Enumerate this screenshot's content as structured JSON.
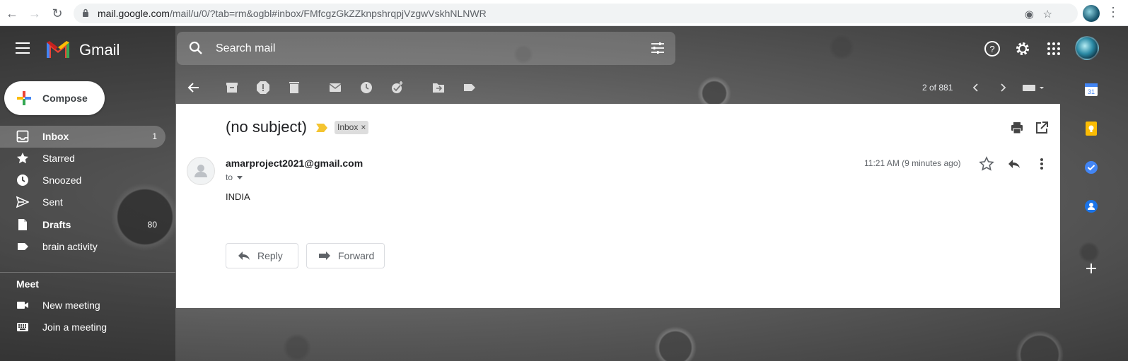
{
  "browser": {
    "url_host": "mail.google.com",
    "url_path": "/mail/u/0/?tab=rm&ogbl#inbox/FMfcgzGkZZknpshrqpjVzgwVskhNLNWR"
  },
  "header": {
    "app_name": "Gmail",
    "search_placeholder": "Search mail"
  },
  "compose": {
    "label": "Compose"
  },
  "sidebar": {
    "items": [
      {
        "label": "Inbox",
        "count": "1"
      },
      {
        "label": "Starred",
        "count": ""
      },
      {
        "label": "Snoozed",
        "count": ""
      },
      {
        "label": "Sent",
        "count": ""
      },
      {
        "label": "Drafts",
        "count": "80"
      },
      {
        "label": "brain activity",
        "count": ""
      }
    ],
    "meet_title": "Meet",
    "meet_items": [
      {
        "label": "New meeting"
      },
      {
        "label": "Join a meeting"
      }
    ]
  },
  "toolbar": {
    "pager": "2 of 881"
  },
  "message": {
    "subject": "(no subject)",
    "label_chip": "Inbox",
    "sender": "amarproject2021@gmail.com",
    "to": "to",
    "timestamp": "11:21 AM (9 minutes ago)",
    "body": "INDIA",
    "reply_label": "Reply",
    "forward_label": "Forward"
  },
  "colors": {
    "gmail_red": "#ea4335",
    "gmail_blue": "#4285f4",
    "gmail_green": "#34a853",
    "gmail_yellow": "#fbbc04"
  }
}
